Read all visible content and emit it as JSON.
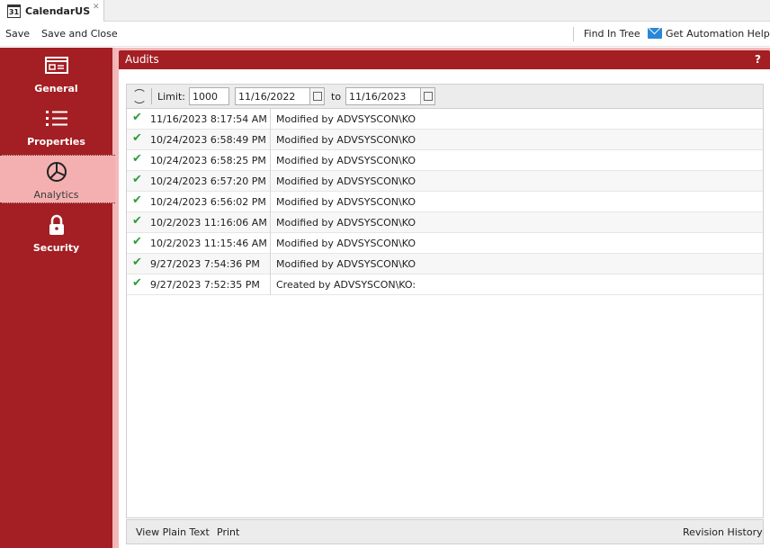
{
  "tab": {
    "title": "CalendarUS",
    "calendar_day": "31"
  },
  "toolbar": {
    "save": "Save",
    "save_close": "Save and Close",
    "find_in_tree": "Find In Tree",
    "automation_help": "Get Automation Help..."
  },
  "sidebar": {
    "items": [
      {
        "label": "General",
        "icon": "form-icon"
      },
      {
        "label": "Properties",
        "icon": "list-icon"
      },
      {
        "label": "Analytics",
        "icon": "pie-chart-icon",
        "active": true
      },
      {
        "label": "Security",
        "icon": "lock-icon"
      }
    ]
  },
  "panel": {
    "title": "Audits",
    "help": "?"
  },
  "filter": {
    "limit_label": "Limit:",
    "limit_value": "1000",
    "from_date": "11/16/2022",
    "to_label": "to",
    "to_date": "11/16/2023"
  },
  "audits": [
    {
      "date": "11/16/2023 8:17:54 AM",
      "desc": "Modified by ADVSYSCON\\KO"
    },
    {
      "date": "10/24/2023 6:58:49 PM",
      "desc": "Modified by ADVSYSCON\\KO"
    },
    {
      "date": "10/24/2023 6:58:25 PM",
      "desc": "Modified by ADVSYSCON\\KO"
    },
    {
      "date": "10/24/2023 6:57:20 PM",
      "desc": "Modified by ADVSYSCON\\KO"
    },
    {
      "date": "10/24/2023 6:56:02 PM",
      "desc": "Modified by ADVSYSCON\\KO"
    },
    {
      "date": "10/2/2023 11:16:06 AM",
      "desc": "Modified by ADVSYSCON\\KO"
    },
    {
      "date": "10/2/2023 11:15:46 AM",
      "desc": "Modified by ADVSYSCON\\KO"
    },
    {
      "date": "9/27/2023 7:54:36 PM",
      "desc": "Modified by ADVSYSCON\\KO"
    },
    {
      "date": "9/27/2023 7:52:35 PM",
      "desc": "Created by ADVSYSCON\\KO:"
    }
  ],
  "footer": {
    "view_plain_text": "View Plain Text",
    "print": "Print",
    "revision_history": "Revision History"
  },
  "colors": {
    "accent": "#a31f24",
    "active_nav": "#f4b0b1",
    "check": "#2e9c3a"
  }
}
